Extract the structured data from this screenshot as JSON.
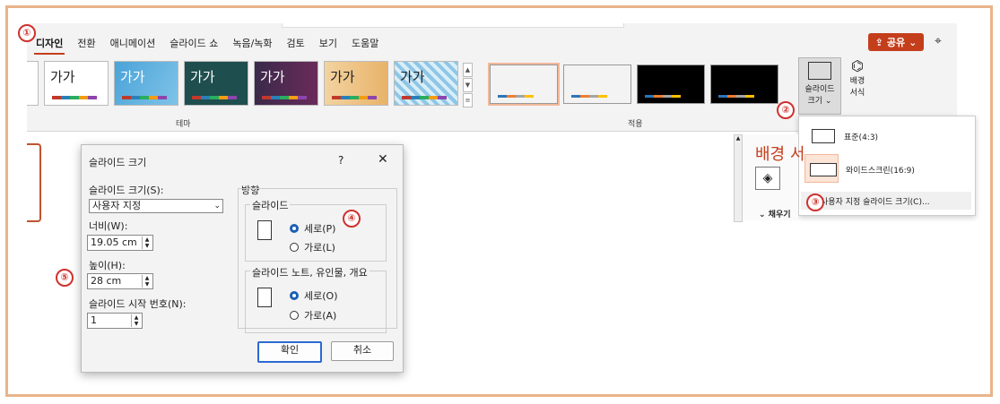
{
  "ribbon": {
    "tabs": [
      "디자인",
      "전환",
      "애니메이션",
      "슬라이드 쇼",
      "녹음/녹화",
      "검토",
      "보기",
      "도움말"
    ],
    "share_label": "공유",
    "share_icon": "share-icon",
    "comment_icon": "comment-icon",
    "theme_group_label": "테마",
    "apply_group_label": "적용",
    "theme_thumb_text": "가가",
    "slide_size_label": "슬라이드 크기",
    "slide_size_line1": "슬라이드",
    "slide_size_line2": "크기 ⌄",
    "bg_format_line1": "배경",
    "bg_format_line2": "서식"
  },
  "dropdown": {
    "standard": "표준(4:3)",
    "widescreen": "와이드스크린(16:9)",
    "custom": "사용자 지정 슬라이드 크기(C)..."
  },
  "format_pane": {
    "title": "배경 서",
    "fill_label": "⌄ 채우기"
  },
  "dialog": {
    "title": "슬라이드 크기",
    "help": "?",
    "close": "✕",
    "size_label": "슬라이드 크기(S):",
    "size_value": "사용자 지정",
    "width_label": "너비(W):",
    "width_value": "19.05 cm",
    "height_label": "높이(H):",
    "height_value": "28 cm",
    "start_label": "슬라이드 시작 번호(N):",
    "start_value": "1",
    "orientation_label": "방향",
    "slides_group": "슬라이드",
    "portrait": "세로(P)",
    "landscape": "가로(L)",
    "notes_group": "슬라이드 노트, 유인물, 개요",
    "notes_portrait": "세로(O)",
    "notes_landscape": "가로(A)",
    "ok": "확인",
    "cancel": "취소"
  },
  "callouts": [
    "①",
    "②",
    "③",
    "④",
    "⑤"
  ],
  "colors": {
    "accent": "#c43e1c",
    "callout": "#d0312d",
    "frame": "#e9b48a"
  }
}
